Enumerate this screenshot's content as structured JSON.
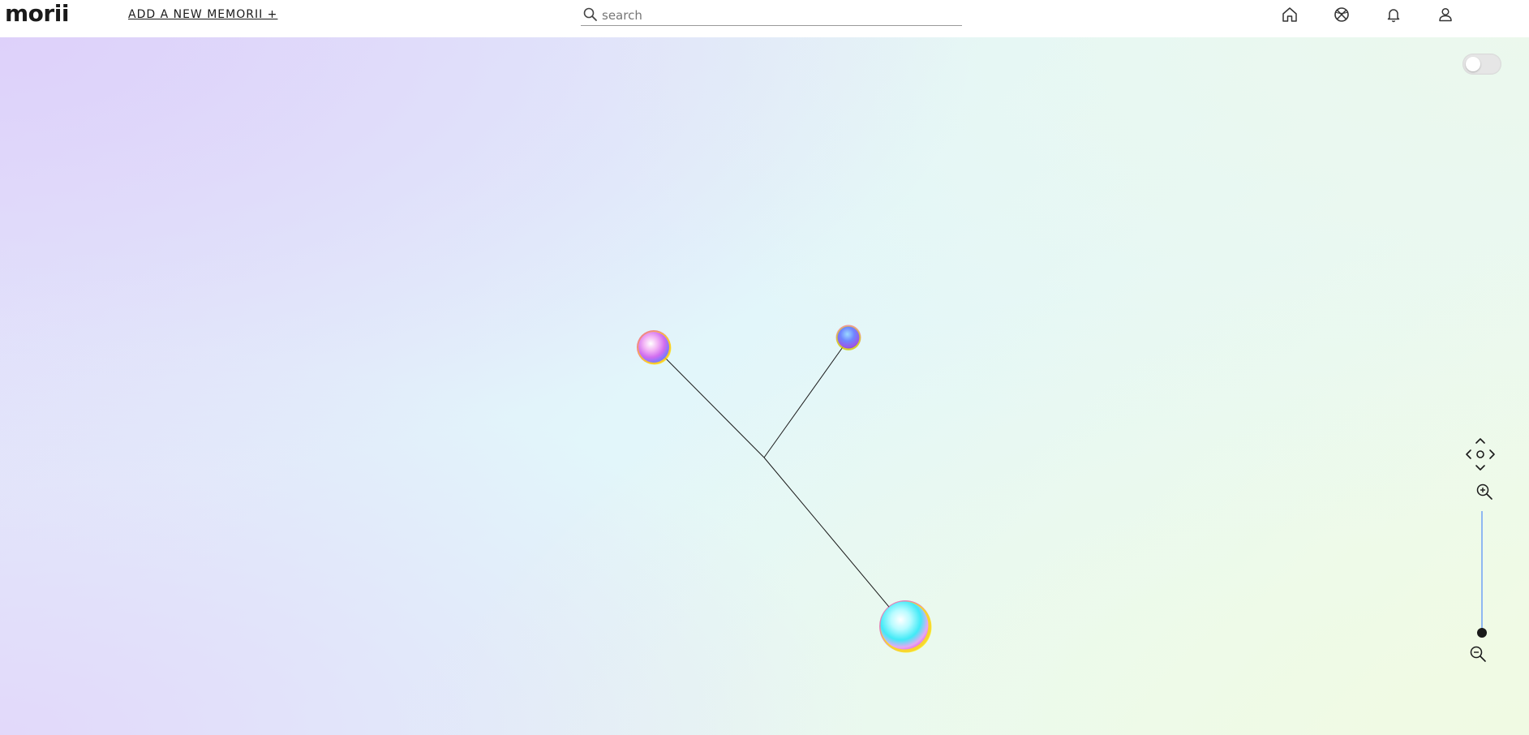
{
  "header": {
    "logo": "morii",
    "add_link": "ADD A NEW MEMORII +",
    "search_placeholder": "search"
  },
  "nav": {
    "icons": [
      "home-icon",
      "basketball-icon",
      "bell-icon",
      "user-icon"
    ]
  },
  "controls": {
    "toggle_state": "off",
    "pan_icons": [
      "chevron-up-icon",
      "chevron-left-icon",
      "center-circle-icon",
      "chevron-right-icon",
      "chevron-down-icon"
    ],
    "zoom_in_icon": "zoom-in-icon",
    "zoom_out_icon": "zoom-out-icon",
    "zoom_level": 0
  },
  "colors": {
    "text": "#1a1a1a",
    "zoom_track": "#8fb7f2"
  }
}
